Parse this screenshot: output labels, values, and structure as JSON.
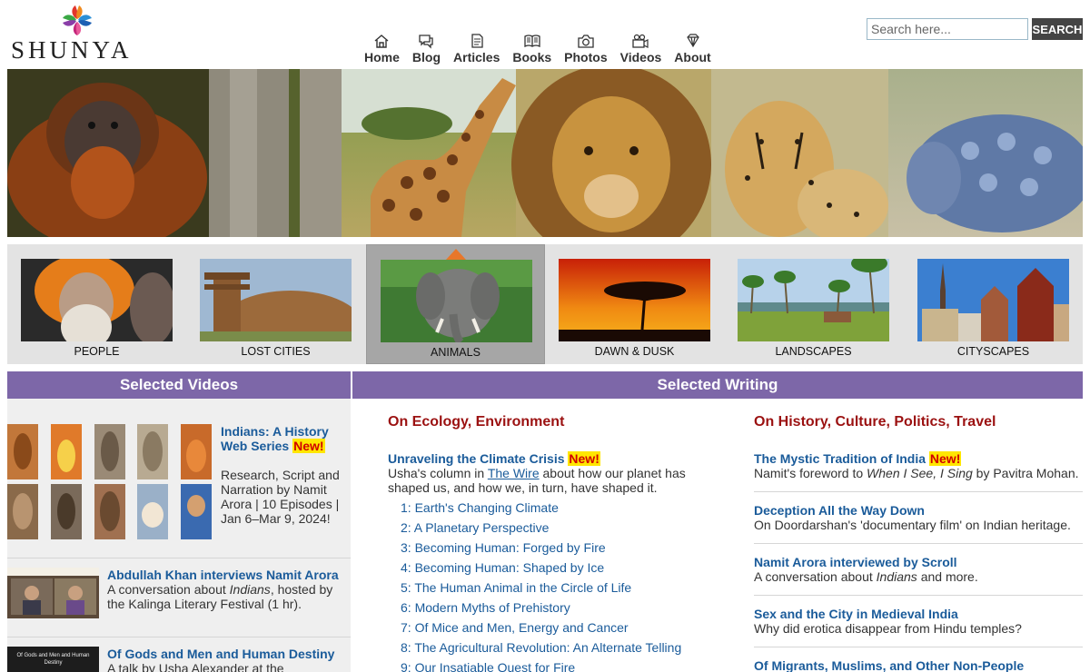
{
  "header": {
    "brand": "SHUNYA",
    "search": {
      "placeholder": "Search here...",
      "button": "SEARCH"
    },
    "nav": [
      {
        "label": "Home",
        "icon": "home-icon"
      },
      {
        "label": "Blog",
        "icon": "chat-icon"
      },
      {
        "label": "Articles",
        "icon": "document-icon"
      },
      {
        "label": "Books",
        "icon": "book-icon"
      },
      {
        "label": "Photos",
        "icon": "camera-icon"
      },
      {
        "label": "Videos",
        "icon": "video-camera-icon"
      },
      {
        "label": "About",
        "icon": "diamond-icon"
      }
    ]
  },
  "categories": [
    {
      "label": "PEOPLE",
      "active": false
    },
    {
      "label": "LOST CITIES",
      "active": false
    },
    {
      "label": "ANIMALS",
      "active": true
    },
    {
      "label": "DAWN & DUSK",
      "active": false
    },
    {
      "label": "LANDSCAPES",
      "active": false
    },
    {
      "label": "CITYSCAPES",
      "active": false
    }
  ],
  "selected_videos": {
    "heading": "Selected Videos",
    "items": [
      {
        "title": "Indians: A History Web Series",
        "badge": "New!",
        "desc": "Research, Script and Narration by Namit Arora | 10 Episodes | Jan 6–Mar 9, 2024!"
      },
      {
        "title": "Abdullah Khan interviews Namit Arora",
        "desc_pre": "A conversation about ",
        "desc_em": "Indians",
        "desc_post": ", hosted by the Kalinga Literary Festival (1 hr)."
      },
      {
        "title": "Of Gods and Men and Human Destiny",
        "desc": "A talk by Usha Alexander at the",
        "thumb_text": "Of Gods and Men and Human Destiny"
      }
    ]
  },
  "selected_writing": {
    "heading": "Selected Writing",
    "ecology": {
      "heading": "On Ecology, Environment",
      "feature": {
        "title": "Unraveling the Climate Crisis",
        "badge": "New!",
        "desc_pre": "Usha's column in ",
        "desc_link": "The Wire",
        "desc_post": " about how our planet has shaped us, and how we, in turn, have shaped it."
      },
      "chapters": [
        "1: Earth's Changing Climate",
        "2: A Planetary Perspective",
        "3: Becoming Human: Forged by Fire",
        "4: Becoming Human: Shaped by Ice",
        "5: The Human Animal in the Circle of Life",
        "6: Modern Myths of Prehistory",
        "7: Of Mice and Men, Energy and Cancer",
        "8: The Agricultural Revolution: An Alternate Telling",
        "9: Our Insatiable Quest for Fire"
      ]
    },
    "history": {
      "heading": "On History, Culture, Politics, Travel",
      "items": [
        {
          "title": "The Mystic Tradition of India",
          "badge": "New!",
          "desc_pre": "Namit's foreword to ",
          "desc_em": "When I See, I Sing",
          "desc_post": " by Pavitra Mohan."
        },
        {
          "title": "Deception All the Way Down",
          "desc_pre": "On Doordarshan's 'documentary film' on Indian heritage.",
          "desc_em": "",
          "desc_post": ""
        },
        {
          "title": "Namit Arora interviewed by Scroll",
          "desc_pre": "A conversation about ",
          "desc_em": "Indians",
          "desc_post": " and more."
        },
        {
          "title": "Sex and the City in Medieval India",
          "desc_pre": "Why did erotica disappear from Hindu temples?",
          "desc_em": "",
          "desc_post": ""
        },
        {
          "title": "Of Migrants, Muslims, and Other Non-People",
          "desc_pre": "",
          "desc_em": "",
          "desc_post": ""
        }
      ]
    }
  }
}
